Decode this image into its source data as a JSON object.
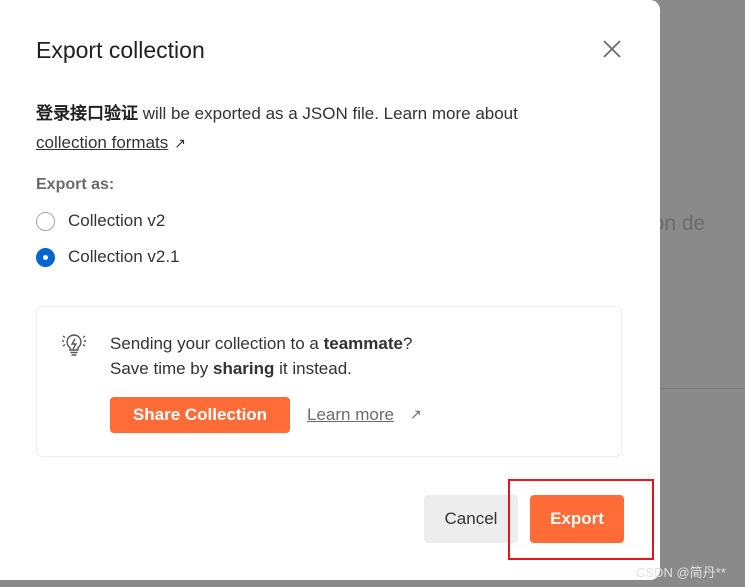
{
  "background": {
    "text": "ection de"
  },
  "dialog": {
    "title": "Export collection",
    "description": {
      "name": "登录接口验证",
      "text": " will be exported as a JSON file. Learn more about ",
      "link": "collection formats"
    },
    "export_as_label": "Export as:",
    "options": [
      {
        "label": "Collection v2",
        "selected": false
      },
      {
        "label": "Collection v2.1",
        "selected": true
      }
    ],
    "share_card": {
      "line1_pre": "Sending your collection to a ",
      "line1_bold": "teammate",
      "line1_post": "?",
      "line2_pre": "Save time by ",
      "line2_bold": "sharing",
      "line2_post": " it instead.",
      "share_button": "Share Collection",
      "learn_more": "Learn more"
    },
    "cancel_label": "Cancel",
    "export_label": "Export"
  },
  "watermark": "CSDN @简丹**",
  "colors": {
    "accent": "#ff6c37",
    "radio": "#0265d2",
    "highlight": "#e8151f"
  }
}
